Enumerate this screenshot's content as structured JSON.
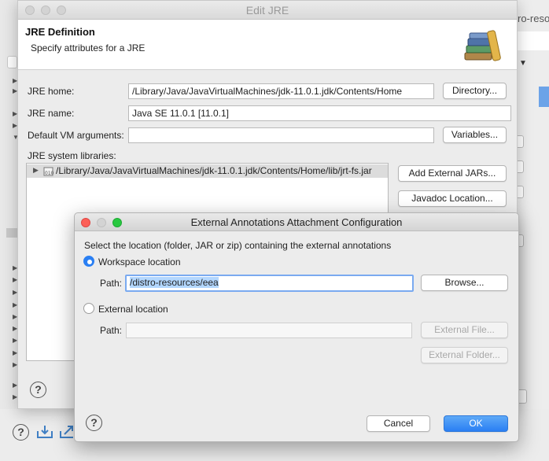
{
  "background": {
    "right_strip_text": "ro-reso"
  },
  "edit_jre": {
    "window_title": "Edit JRE",
    "header_title": "JRE Definition",
    "header_subtitle": "Specify attributes for a JRE",
    "jre_home_label": "JRE home:",
    "jre_home_value": "/Library/Java/JavaVirtualMachines/jdk-11.0.1.jdk/Contents/Home",
    "directory_button": "Directory...",
    "jre_name_label": "JRE name:",
    "jre_name_value": "Java SE 11.0.1 [11.0.1]",
    "vm_args_label": "Default VM arguments:",
    "vm_args_value": "",
    "variables_button": "Variables...",
    "libraries_label": "JRE system libraries:",
    "libraries": [
      {
        "path": "/Library/Java/JavaVirtualMachines/jdk-11.0.1.jdk/Contents/Home/lib/jrt-fs.jar"
      }
    ],
    "add_external_jars_button": "Add External JARs...",
    "javadoc_location_button": "Javadoc Location..."
  },
  "ext_dialog": {
    "title": "External Annotations Attachment Configuration",
    "instruction": "Select the location (folder, JAR or zip) containing the external annotations",
    "workspace_option": "Workspace location",
    "workspace_path_label": "Path:",
    "workspace_path_value": "/distro-resources/eea",
    "browse_button": "Browse...",
    "external_option": "External location",
    "external_path_label": "Path:",
    "external_path_value": "",
    "external_file_button": "External File...",
    "external_folder_button": "External Folder...",
    "cancel_button": "Cancel",
    "ok_button": "OK",
    "workspace_selected": true
  },
  "colors": {
    "accent": "#2a7ff3",
    "selection": "#b3d7ff",
    "close_light": "#fc5f57",
    "minimize_light": "#fdbc2e",
    "zoom_light": "#28c840"
  }
}
